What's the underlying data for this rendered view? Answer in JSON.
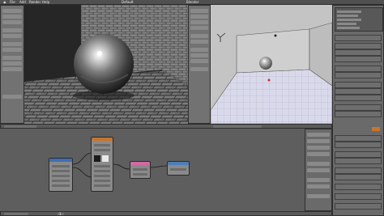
{
  "window": {
    "title_text": "Blender",
    "menu": [
      "File",
      "Add",
      "Render",
      "Help"
    ],
    "editor_label": "Default"
  },
  "viewport_left": {
    "name": "Rendered Viewport",
    "sphere": "chrome-sphere",
    "floor": "brick-floor"
  },
  "viewport_right": {
    "name": "Solid Viewport",
    "sphere": "chrome-sphere"
  },
  "node_editor": {
    "nodes": [
      {
        "label": "Texture Coordinate",
        "header_color": "#3d6fb5"
      },
      {
        "label": "Brick Texture",
        "header_color": "#c8742f"
      },
      {
        "label": "Glossy BSDF",
        "header_color": "#d06aa3"
      },
      {
        "label": "Material Output",
        "header_color": "#4d7fb6"
      }
    ]
  },
  "status": {
    "frame": "1"
  },
  "colors": {
    "panel_bg": "#727272",
    "viewport_bg_right": "#b6b6b6",
    "accent_orange": "#c8742f",
    "node_editor_bg": "#5e5e5e"
  }
}
